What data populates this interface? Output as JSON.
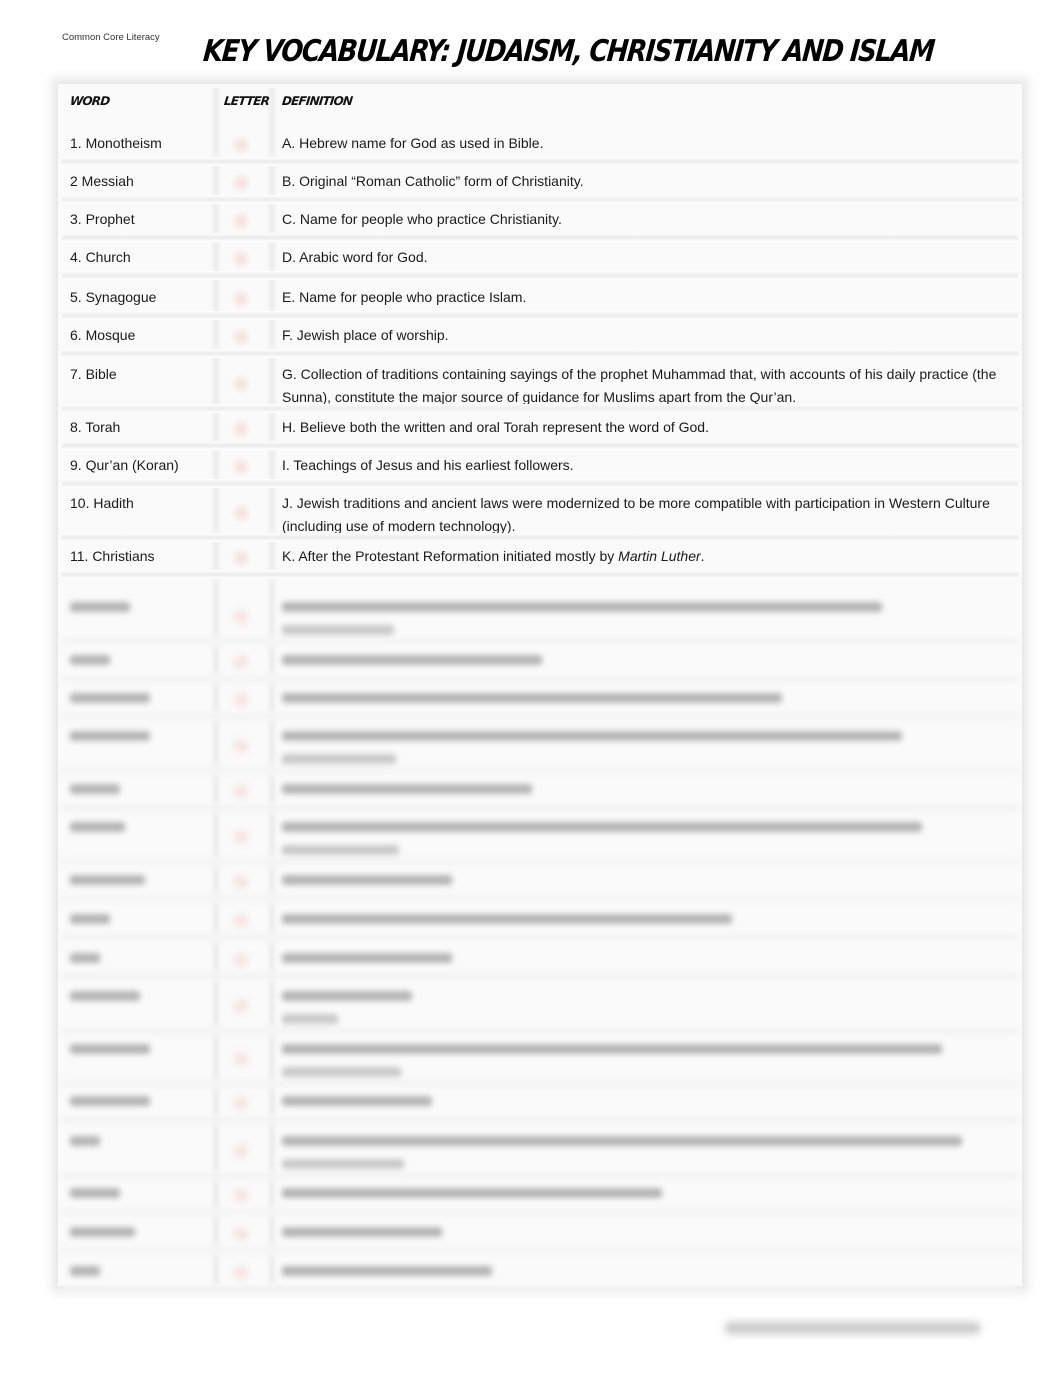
{
  "header": {
    "course_label": "Common Core Literacy",
    "title": "Key Vocabulary: Judaism, Christianity and Islam"
  },
  "table": {
    "columns": [
      "Word",
      "Letter",
      "Definition"
    ],
    "rows": [
      {
        "word": "1. Monotheism",
        "letter": "",
        "definition": "A. Hebrew name for God as used in Bible."
      },
      {
        "word": "2 Messiah",
        "letter": "",
        "definition": "B. Original “Roman Catholic” form of Christianity."
      },
      {
        "word": "3. Prophet",
        "letter": "",
        "definition": "C. Name for people who practice Christianity."
      },
      {
        "word": "4. Church",
        "letter": "",
        "definition": "D. Arabic word for God."
      },
      {
        "word": "5. Synagogue",
        "letter": "",
        "definition": "E. Name for people who practice Islam."
      },
      {
        "word": "6. Mosque",
        "letter": "",
        "definition": "F. Jewish place of worship."
      },
      {
        "word": "7. Bible",
        "letter": "",
        "definition": "G. Collection of traditions containing sayings of the prophet Muhammad that, with accounts of his daily practice (the Sunna), constitute the major source of guidance for Muslims apart from the Qur’an."
      },
      {
        "word": "8. Torah",
        "letter": "",
        "definition": "H.  Believe both the written and oral Torah represent the word of God."
      },
      {
        "word": "9. Qur’an (Koran)",
        "letter": "",
        "definition": "I. Teachings of Jesus and his earliest followers."
      },
      {
        "word": "10. Hadith",
        "letter": "",
        "definition": "J. Jewish traditions and ancient laws were modernized to be more compatible with participation in Western Culture (including use of modern technology)."
      },
      {
        "word": "11. Christians",
        "letter": "",
        "definition_prefix": "K. After the Protestant Reformation initiated mostly by ",
        "definition_emphasis": "Martin Luther",
        "definition_suffix": "."
      }
    ],
    "blurred_row_count": 16
  }
}
